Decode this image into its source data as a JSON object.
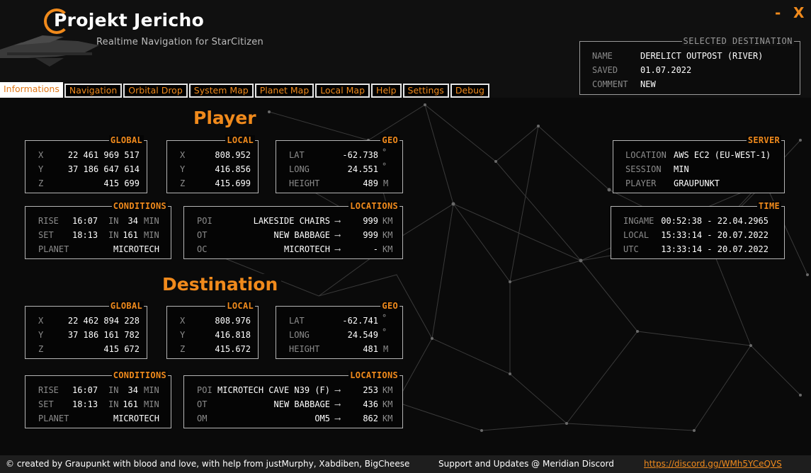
{
  "app": {
    "title": "Projekt Jericho",
    "subtitle": "Realtime Navigation for StarCitizen",
    "minimize_label": "-",
    "close_label": "X"
  },
  "selected_destination": {
    "title": "SELECTED DESTINATION",
    "name_label": "NAME",
    "name": "DERELICT OUTPOST (RIVER)",
    "saved_label": "SAVED",
    "saved": "01.07.2022",
    "comment_label": "COMMENT",
    "comment": "NEW"
  },
  "tabs": [
    "Informations",
    "Navigation",
    "Orbital Drop",
    "System Map",
    "Planet Map",
    "Local Map",
    "Help",
    "Settings",
    "Debug"
  ],
  "player": {
    "title": "Player",
    "global": {
      "title": "GLOBAL",
      "x_label": "X",
      "x": "22 461 969 517",
      "y_label": "Y",
      "y": "37 186 647 614",
      "z_label": "Z",
      "z": "415 699"
    },
    "local": {
      "title": "LOCAL",
      "x_label": "X",
      "x": "808.952",
      "y_label": "Y",
      "y": "416.856",
      "z_label": "Z",
      "z": "415.699"
    },
    "geo": {
      "title": "GEO",
      "lat_label": "LAT",
      "lat": "-62.738",
      "lat_unit": "°",
      "long_label": "LONG",
      "long": "24.551",
      "long_unit": "°",
      "height_label": "HEIGHT",
      "height": "489",
      "height_unit": "M"
    },
    "conditions": {
      "title": "CONDITIONS",
      "rise_label": "RISE",
      "rise": "16:07",
      "rise_in_label": "IN",
      "rise_in": "34",
      "rise_unit": "MIN",
      "set_label": "SET",
      "set": "18:13",
      "set_in_label": "IN",
      "set_in": "161",
      "set_unit": "MIN",
      "planet_label": "PLANET",
      "planet": "MICROTECH"
    },
    "locations": {
      "title": "LOCATIONS",
      "rows": [
        {
          "label": "POI",
          "name": "LAKESIDE CHAIRS",
          "arrow": "⟶",
          "dist": "999",
          "unit": "KM"
        },
        {
          "label": "OT",
          "name": "NEW BABBAGE",
          "arrow": "⟶",
          "dist": "999",
          "unit": "KM"
        },
        {
          "label": "OC",
          "name": "MICROTECH",
          "arrow": "⟶",
          "dist": "-",
          "unit": "KM"
        }
      ]
    }
  },
  "destination": {
    "title": "Destination",
    "global": {
      "title": "GLOBAL",
      "x_label": "X",
      "x": "22 462 894 228",
      "y_label": "Y",
      "y": "37 186 161 782",
      "z_label": "Z",
      "z": "415 672"
    },
    "local": {
      "title": "LOCAL",
      "x_label": "X",
      "x": "808.976",
      "y_label": "Y",
      "y": "416.818",
      "z_label": "Z",
      "z": "415.672"
    },
    "geo": {
      "title": "GEO",
      "lat_label": "LAT",
      "lat": "-62.741",
      "lat_unit": "°",
      "long_label": "LONG",
      "long": "24.549",
      "long_unit": "°",
      "height_label": "HEIGHT",
      "height": "481",
      "height_unit": "M"
    },
    "conditions": {
      "title": "CONDITIONS",
      "rise_label": "RISE",
      "rise": "16:07",
      "rise_in_label": "IN",
      "rise_in": "34",
      "rise_unit": "MIN",
      "set_label": "SET",
      "set": "18:13",
      "set_in_label": "IN",
      "set_in": "161",
      "set_unit": "MIN",
      "planet_label": "PLANET",
      "planet": "MICROTECH"
    },
    "locations": {
      "title": "LOCATIONS",
      "rows": [
        {
          "label": "POI",
          "name": "MICROTECH CAVE N39 (F)",
          "arrow": "⟶",
          "dist": "253",
          "unit": "KM"
        },
        {
          "label": "OT",
          "name": "NEW BABBAGE",
          "arrow": "⟶",
          "dist": "436",
          "unit": "KM"
        },
        {
          "label": "OM",
          "name": "OM5",
          "arrow": "⟶",
          "dist": "862",
          "unit": "KM"
        }
      ]
    }
  },
  "server": {
    "title": "SERVER",
    "location_label": "LOCATION",
    "location": "AWS EC2 (EU-WEST-1)",
    "session_label": "SESSION",
    "session": "MIN",
    "player_label": "PLAYER",
    "player": "GRAUPUNKT"
  },
  "time": {
    "title": "TIME",
    "ingame_label": "INGAME",
    "ingame": "00:52:38 - 22.04.2965",
    "local_label": "LOCAL",
    "local": "15:33:14 - 20.07.2022",
    "utc_label": "UTC",
    "utc": "13:33:14 - 20.07.2022"
  },
  "footer": {
    "credits": "© created by Graupunkt with blood and love, with help from justMurphy, Xabdiben, BigCheese",
    "support": "Support and Updates @ Meridian Discord",
    "link": "https://discord.gg/WMh5YCeQVS"
  },
  "colors": {
    "accent": "#f08a1c",
    "background": "#0a0a0a",
    "panel_border": "#b5b5b5"
  }
}
